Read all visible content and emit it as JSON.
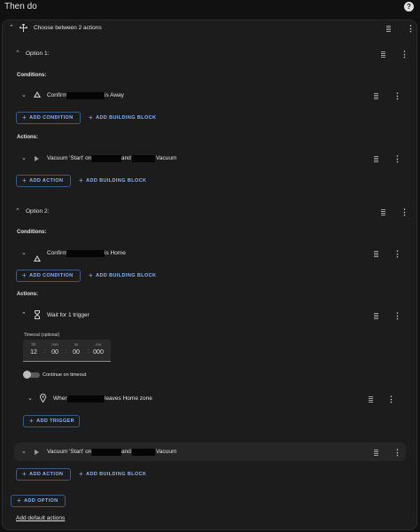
{
  "page": {
    "title": "Then do"
  },
  "choose": {
    "label": "Choose between 2 actions"
  },
  "option1": {
    "label": "Option 1:",
    "conditions_label": "Conditions:",
    "condition": {
      "prefix": "Confirm",
      "suffix": "is Away"
    },
    "add_condition": "ADD CONDITION",
    "add_building_block": "ADD BUILDING BLOCK",
    "actions_label": "Actions:",
    "action": {
      "prefix": "Vacuum 'Start' on",
      "mid": "and",
      "suffix": "Vacuum"
    },
    "add_action": "ADD ACTION",
    "add_building_block_2": "ADD BUILDING BLOCK"
  },
  "option2": {
    "label": "Option 2:",
    "conditions_label": "Conditions:",
    "condition": {
      "prefix": "Confirm",
      "suffix": "is Home"
    },
    "add_condition": "ADD CONDITION",
    "add_building_block": "ADD BUILDING BLOCK",
    "actions_label": "Actions:",
    "wait": {
      "label": "Wait for 1 trigger",
      "timeout_label": "Timeout (optional)",
      "units": [
        "hh",
        "mm",
        "ss",
        "ms"
      ],
      "values": [
        "12",
        "00",
        "00",
        "000"
      ],
      "continue_label": "Continue on timeout",
      "trigger": {
        "prefix": "When",
        "suffix": "leaves Home zone"
      },
      "add_trigger": "ADD TRIGGER"
    },
    "action": {
      "prefix": "Vacuum 'Start' on",
      "mid": "and",
      "suffix": "Vacuum"
    },
    "add_action": "ADD ACTION",
    "add_building_block_2": "ADD BUILDING BLOCK"
  },
  "add_option": "ADD OPTION",
  "add_default_actions": "Add default actions",
  "icons": {
    "help": "help-circle-icon",
    "choose": "arrow-decision-icon",
    "condition": "triangle-state-icon",
    "action": "play-icon",
    "wait": "timer-sand-icon",
    "trigger": "map-marker-icon",
    "drag": "drag-handle-icon",
    "menu": "dots-vertical-icon"
  },
  "colors": {
    "accent": "#8ab4f8",
    "background": "#111111",
    "card": "#1c1c1c"
  }
}
